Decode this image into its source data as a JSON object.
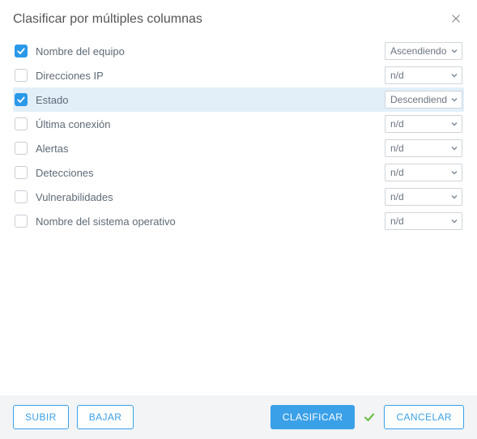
{
  "dialog": {
    "title": "Clasificar por múltiples columnas"
  },
  "rows": [
    {
      "label": "Nombre del equipo",
      "checked": true,
      "selected": false,
      "value": "Ascendiendo"
    },
    {
      "label": "Direcciones IP",
      "checked": false,
      "selected": false,
      "value": "n/d"
    },
    {
      "label": "Estado",
      "checked": true,
      "selected": true,
      "value": "Descendiendo"
    },
    {
      "label": "Última conexión",
      "checked": false,
      "selected": false,
      "value": "n/d"
    },
    {
      "label": "Alertas",
      "checked": false,
      "selected": false,
      "value": "n/d"
    },
    {
      "label": "Detecciones",
      "checked": false,
      "selected": false,
      "value": "n/d"
    },
    {
      "label": "Vulnerabilidades",
      "checked": false,
      "selected": false,
      "value": "n/d"
    },
    {
      "label": "Nombre del sistema operativo",
      "checked": false,
      "selected": false,
      "value": "n/d"
    }
  ],
  "footer": {
    "subir": "SUBIR",
    "bajar": "BAJAR",
    "clasificar": "CLASIFICAR",
    "cancelar": "CANCELAR"
  }
}
